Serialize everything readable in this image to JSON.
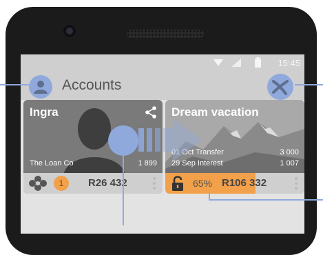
{
  "status_bar": {
    "time": "15:45"
  },
  "app_bar": {
    "title": "Accounts"
  },
  "cards": [
    {
      "title": "Ingra",
      "line_label": "The Loan Co",
      "line_value": "1 899",
      "badge_count": "1",
      "balance": "R26 432"
    },
    {
      "title": "Dream vacation",
      "transactions": [
        {
          "label": "01 Oct Transfer",
          "value": "3 000"
        },
        {
          "label": "29 Sep Interest",
          "value": "1 007"
        }
      ],
      "progress_text": "65%",
      "progress_fraction": 0.65,
      "balance": "R106 332"
    }
  ],
  "colors": {
    "accent_orange": "#f2a04a",
    "overlay_blue": "#8fa9dc",
    "app_bar": "#cfcfcf"
  },
  "icons": [
    "avatar-person-icon",
    "close-x-icon",
    "share-icon",
    "flower-icon",
    "lock-open-icon",
    "kebab-icon",
    "wifi-icon",
    "signal-icon",
    "battery-icon"
  ]
}
